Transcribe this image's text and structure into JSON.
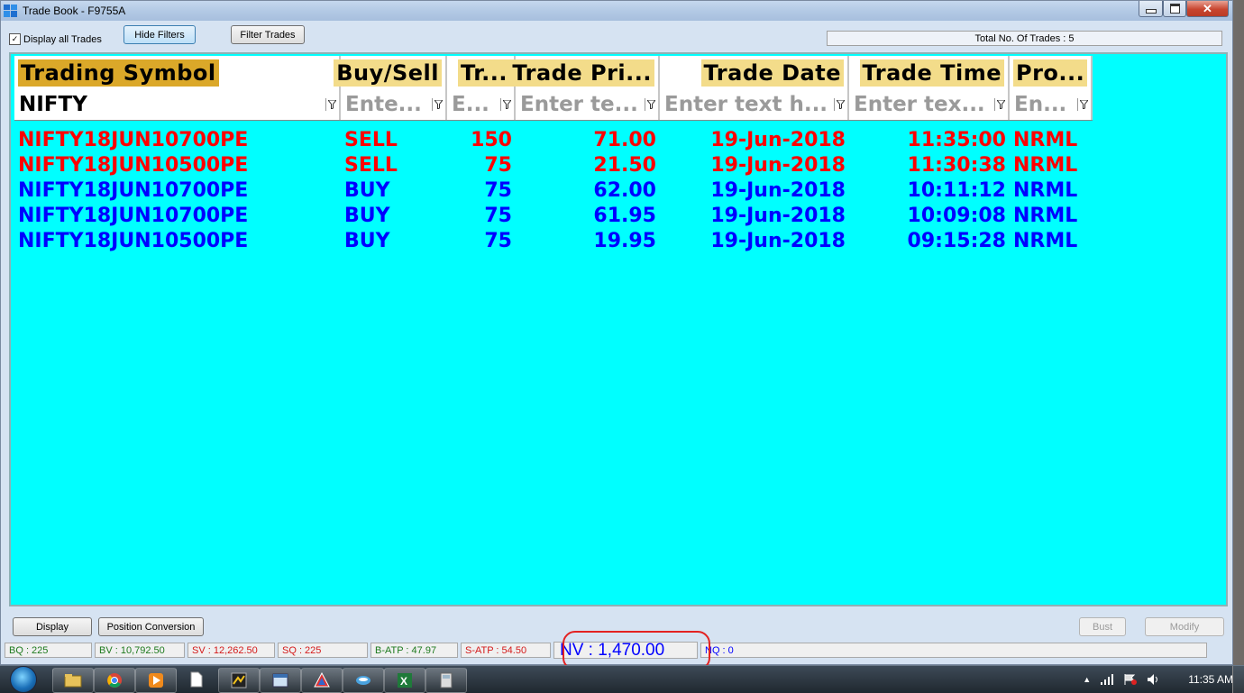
{
  "window": {
    "title": "Trade Book - F9755A"
  },
  "toolbar": {
    "display_all_label": "Display all Trades",
    "display_all_checked": "✓",
    "hide_filters_label": "Hide Filters",
    "filter_trades_label": "Filter Trades",
    "total_trades": "Total No. Of Trades : 5"
  },
  "grid": {
    "headers": [
      "Trading Symbol",
      "Buy/Sell",
      "Tr...",
      "Trade Pri...",
      "Trade Date",
      "Trade Time",
      "Pro..."
    ],
    "filters": [
      "NIFTY",
      "Ente...",
      "E...",
      "Enter te...",
      "Enter text h...",
      "Enter tex...",
      "En..."
    ],
    "rows": [
      {
        "symbol": "NIFTY18JUN10700PE",
        "side": "SELL",
        "qty": "150",
        "price": "71.00",
        "date": "19-Jun-2018",
        "time": "11:35:00",
        "product": "NRML"
      },
      {
        "symbol": "NIFTY18JUN10500PE",
        "side": "SELL",
        "qty": "75",
        "price": "21.50",
        "date": "19-Jun-2018",
        "time": "11:30:38",
        "product": "NRML"
      },
      {
        "symbol": "NIFTY18JUN10700PE",
        "side": "BUY",
        "qty": "75",
        "price": "62.00",
        "date": "19-Jun-2018",
        "time": "10:11:12",
        "product": "NRML"
      },
      {
        "symbol": "NIFTY18JUN10700PE",
        "side": "BUY",
        "qty": "75",
        "price": "61.95",
        "date": "19-Jun-2018",
        "time": "10:09:08",
        "product": "NRML"
      },
      {
        "symbol": "NIFTY18JUN10500PE",
        "side": "BUY",
        "qty": "75",
        "price": "19.95",
        "date": "19-Jun-2018",
        "time": "09:15:28",
        "product": "NRML"
      }
    ],
    "colors": {
      "sell": "#ff0000",
      "buy": "#0000ff",
      "background": "#00ffff"
    }
  },
  "actions": {
    "display_label": "Display",
    "position_conversion_label": "Position Conversion",
    "bust_label": "Bust",
    "modify_label": "Modify"
  },
  "status": {
    "bq": "BQ : 225",
    "bv": "BV : 10,792.50",
    "sv": "SV : 12,262.50",
    "sq": "SQ : 225",
    "batp": "B-ATP : 47.97",
    "satp": "S-ATP : 54.50",
    "nv": "NV : 1,470.00",
    "nq": "NQ : 0"
  },
  "taskbar": {
    "clock": "11:35 AM",
    "items": [
      "explorer-icon",
      "chrome-icon",
      "media-player-icon",
      "document-icon",
      "trading-app-icon",
      "window-icon",
      "app-icon",
      "app-icon",
      "excel-icon",
      "calculator-icon"
    ]
  }
}
